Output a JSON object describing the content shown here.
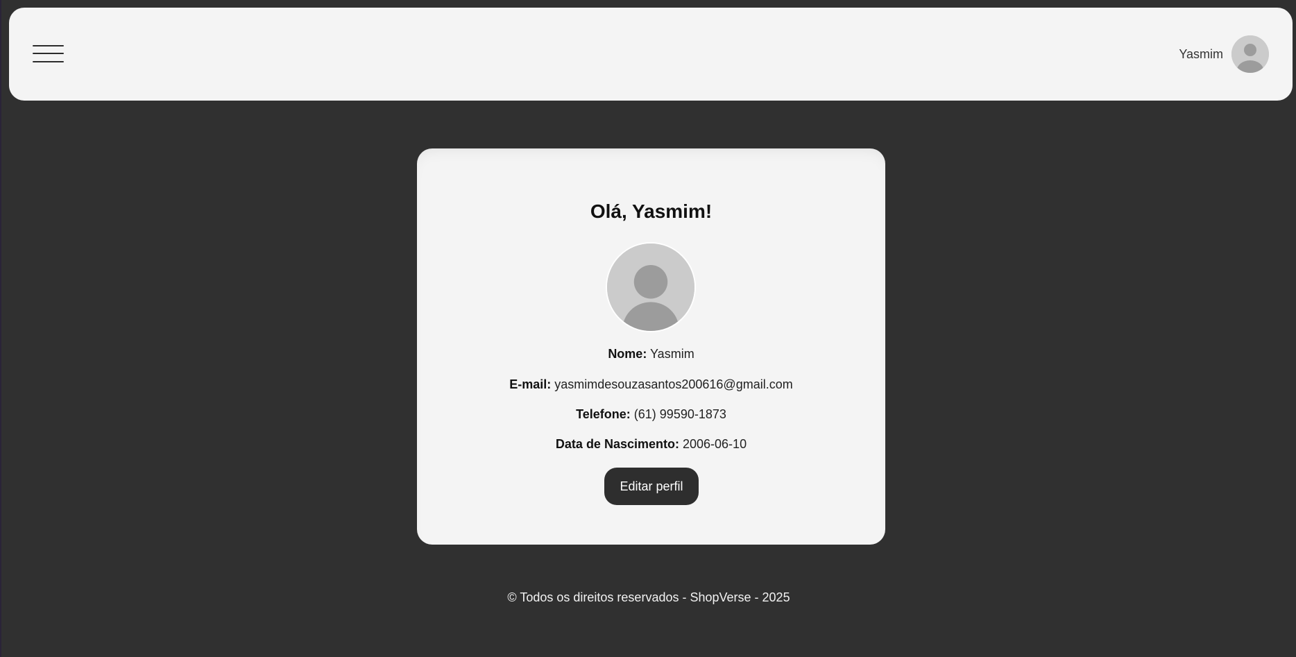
{
  "header": {
    "menu_icon": "hamburger-menu-icon",
    "user_name": "Yasmim",
    "avatar_icon": "user-avatar-icon"
  },
  "profile": {
    "greeting": "Olá, Yasmim!",
    "avatar_icon": "user-avatar-icon",
    "fields": {
      "name_label": "Nome:",
      "name_value": "Yasmim",
      "email_label": "E-mail:",
      "email_value": "yasmimdesouzasantos200616@gmail.com",
      "phone_label": "Telefone:",
      "phone_value": "(61) 99590-1873",
      "birth_label": "Data de Nascimento:",
      "birth_value": "2006-06-10"
    },
    "edit_button": "Editar perfil"
  },
  "footer": {
    "text": "© Todos os direitos reservados - ShopVerse - 2025"
  },
  "colors": {
    "background": "#303030",
    "surface": "#f4f4f4",
    "button": "#2e2e2e",
    "avatar_bg": "#cbcbcb",
    "avatar_fg": "#9c9c9c"
  }
}
